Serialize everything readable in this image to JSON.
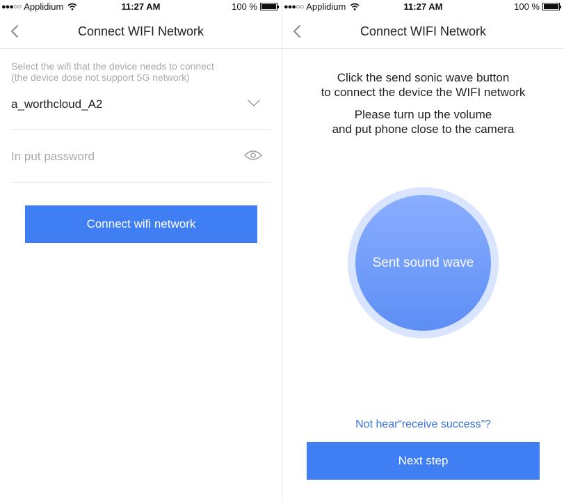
{
  "status_bar": {
    "signal": "●●●○○",
    "carrier": "Applidium",
    "time": "11:27 AM",
    "battery_text": "100 %",
    "wifi_icon": "wifi-icon",
    "battery_icon": "battery-icon"
  },
  "left_screen": {
    "nav": {
      "title": "Connect WIFI Network",
      "back_icon": "chevron-left-icon"
    },
    "hint_line1": "Select the wifi that the device needs to connect",
    "hint_line2": "(the device dose not support 5G network)",
    "ssid_value": "a_worthcloud_A2",
    "ssid_icon": "chevron-down-icon",
    "password_placeholder": "In put password",
    "password_value": "",
    "password_icon": "eye-icon",
    "connect_button": "Connect wifi network"
  },
  "right_screen": {
    "nav": {
      "title": "Connect WIFI Network",
      "back_icon": "chevron-left-icon"
    },
    "instruction_a1": "Click the send sonic wave button",
    "instruction_a2": "to connect the device the WIFI network",
    "instruction_b1": "Please turn up the volume",
    "instruction_b2": "and put phone close to the camera",
    "wave_button": "Sent sound wave",
    "not_hear_link": "Not hear“receive success”?",
    "next_button": "Next step"
  },
  "colors": {
    "accent": "#3f7ef3",
    "link": "#3a72dd",
    "wave_ring": "#d9e4ff",
    "hint_text": "#aaaaaa"
  }
}
